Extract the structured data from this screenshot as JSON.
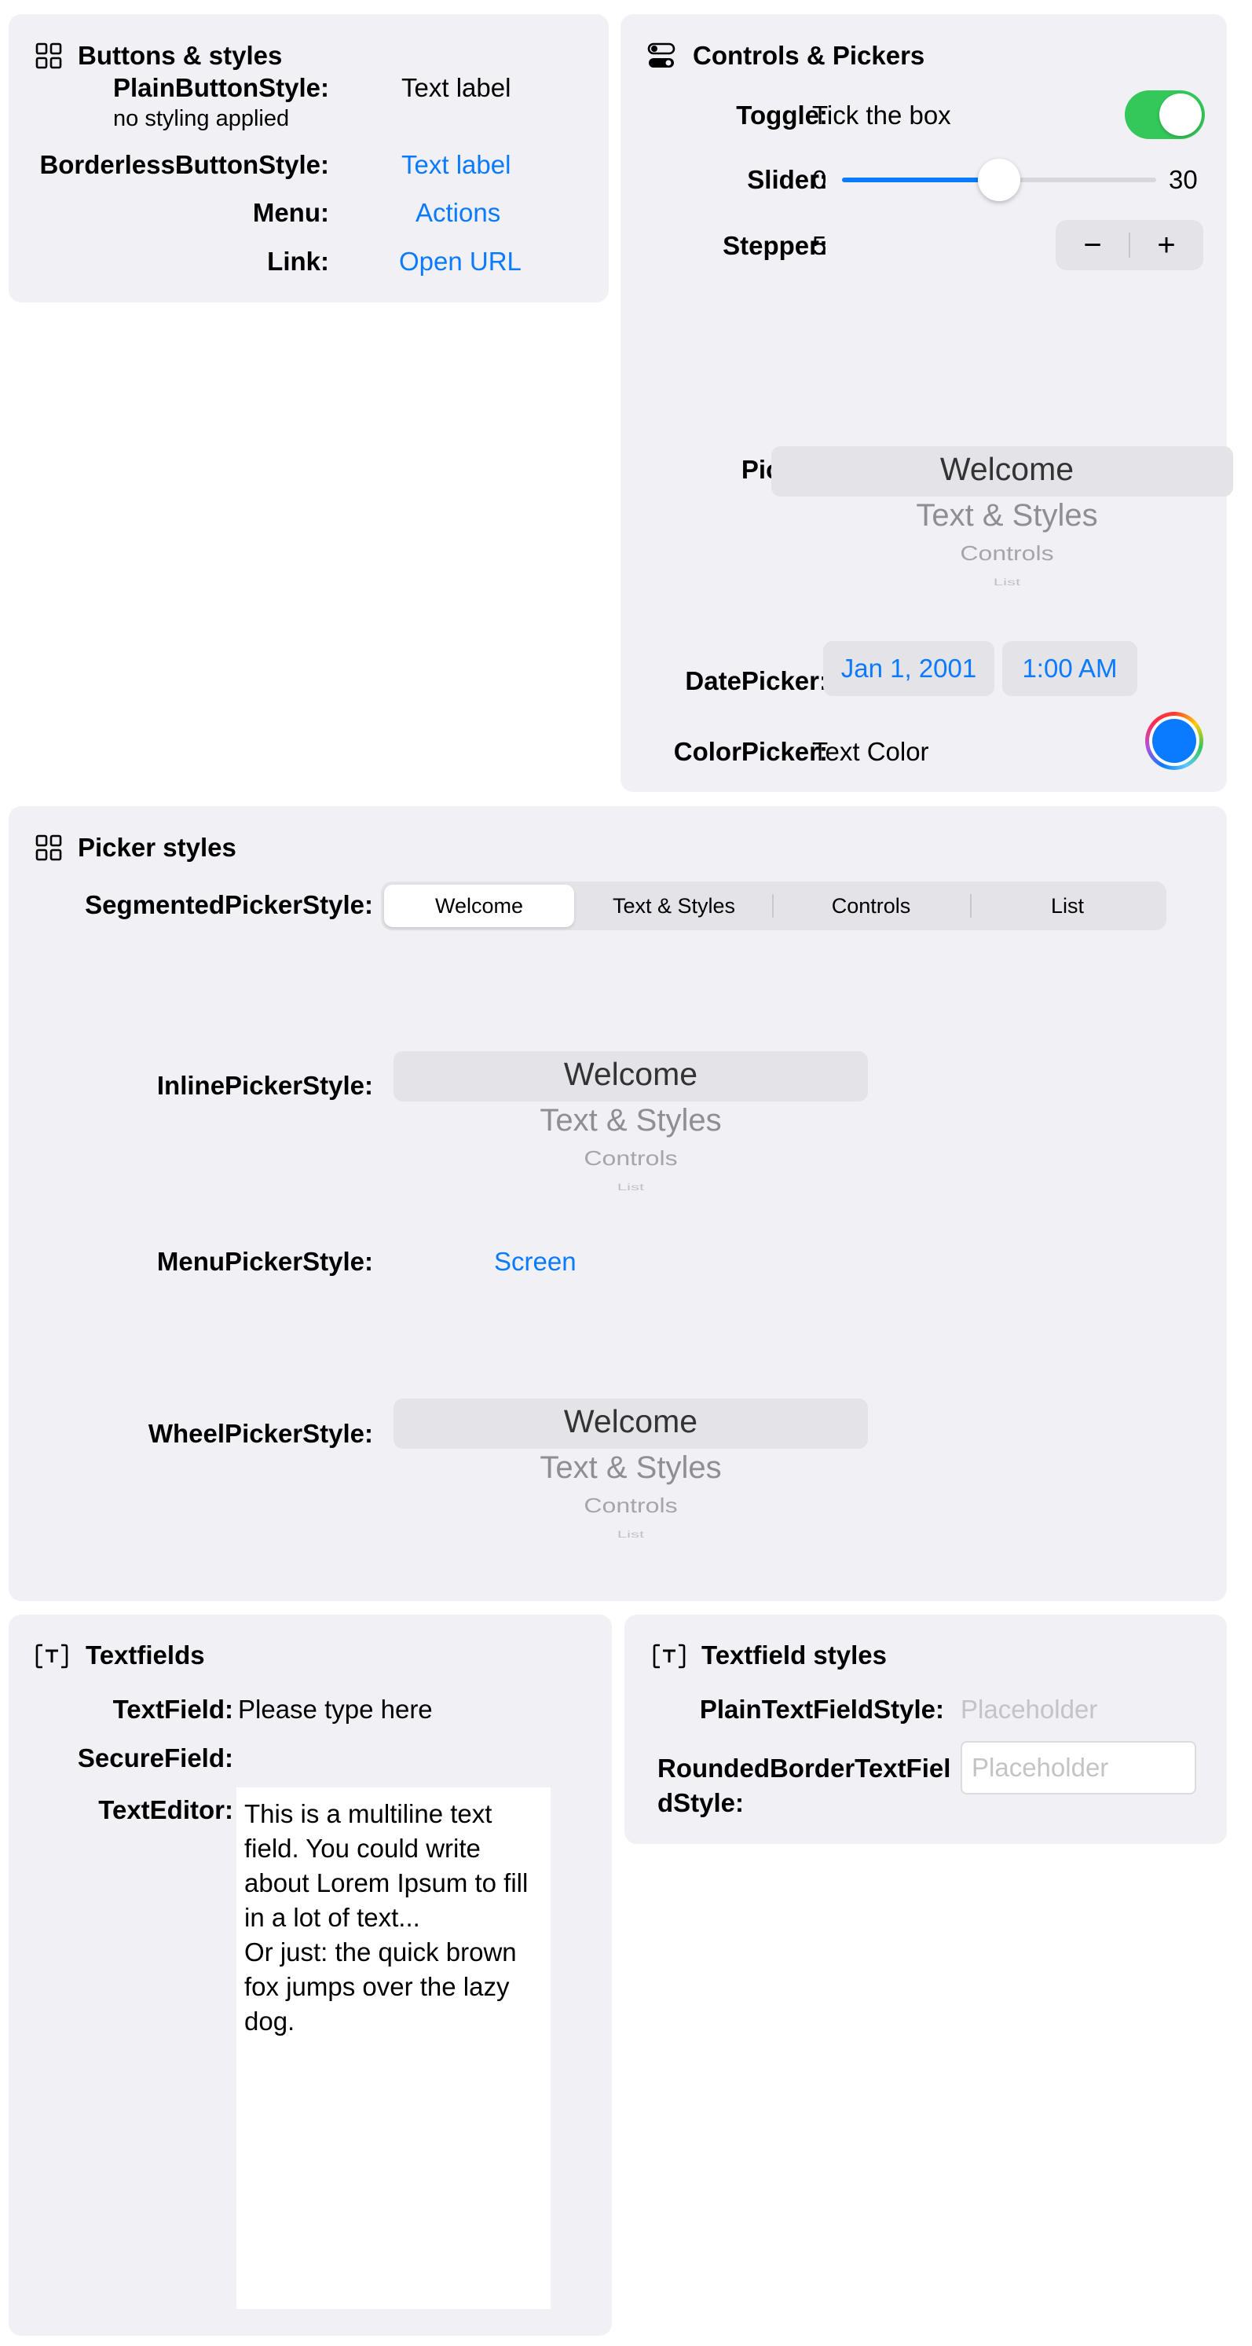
{
  "buttons": {
    "title": "Buttons & styles",
    "plain_label": "PlainButtonStyle:",
    "plain_sublabel": "no styling applied",
    "plain_value": "Text label",
    "borderless_label": "BorderlessButtonStyle:",
    "borderless_value": "Text label",
    "menu_label": "Menu:",
    "menu_value": "Actions",
    "link_label": "Link:",
    "link_value": "Open URL"
  },
  "controls": {
    "title": "Controls & Pickers",
    "toggle_label": "Toggle:",
    "toggle_text": "Tick the box",
    "toggle_on": true,
    "slider_label": "Slider:",
    "slider_min": "0",
    "slider_max": "30",
    "slider_value": 15,
    "stepper_label": "Stepper:",
    "stepper_value": "5",
    "stepper_minus": "−",
    "stepper_plus": "+",
    "picker_label": "Picker:",
    "picker_items": [
      "Welcome",
      "Text & Styles",
      "Controls",
      "List"
    ],
    "datepicker_label": "DatePicker:",
    "date_value": "Jan 1, 2001",
    "time_value": "1:00 AM",
    "colorpicker_label": "ColorPicker:",
    "colorpicker_text": "Text Color",
    "color_value": "#0a7aff"
  },
  "picker_styles": {
    "title": "Picker styles",
    "segmented_label": "SegmentedPickerStyle:",
    "segments": [
      "Welcome",
      "Text & Styles",
      "Controls",
      "List"
    ],
    "inline_label": "InlinePickerStyle:",
    "inline_items": [
      "Welcome",
      "Text & Styles",
      "Controls",
      "List"
    ],
    "menu_label": "MenuPickerStyle:",
    "menu_value": "Screen",
    "wheel_label": "WheelPickerStyle:",
    "wheel_items": [
      "Welcome",
      "Text & Styles",
      "Controls",
      "List"
    ]
  },
  "textfields": {
    "title": "Textfields",
    "textfield_label": "TextField:",
    "textfield_value": "Please type here",
    "securefield_label": "SecureField:",
    "texteditor_label": "TextEditor:",
    "texteditor_value": "This is a multiline text field. You could write about Lorem Ipsum to fill in a lot of text...\nOr just: the quick brown fox jumps over the lazy dog."
  },
  "textfield_styles": {
    "title": "Textfield styles",
    "plain_label": "PlainTextFieldStyle:",
    "plain_placeholder": "Placeholder",
    "rounded_label_1": "RoundedBorderTextFiel",
    "rounded_label_2": "dStyle:",
    "rounded_placeholder": "Placeholder"
  }
}
